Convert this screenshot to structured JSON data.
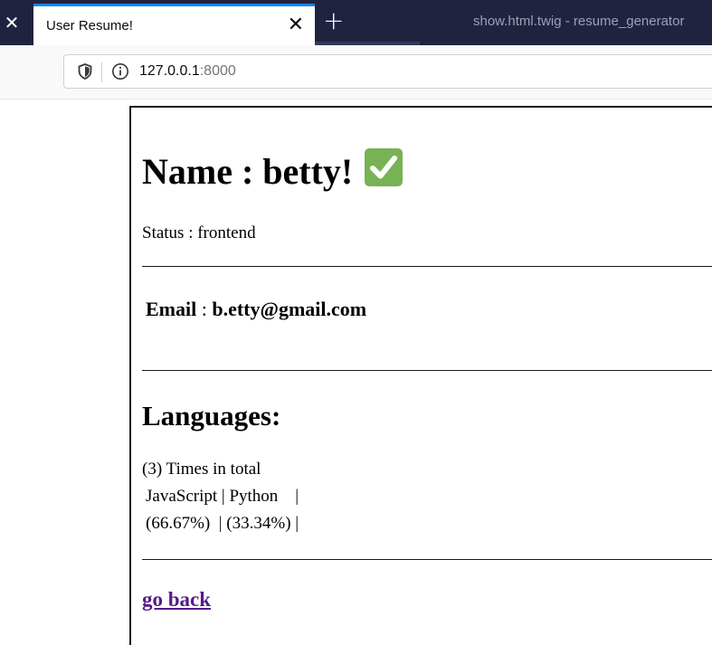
{
  "browser": {
    "tab_title": "User Resume!",
    "tab_close_glyph": "✕",
    "left_close_glyph": "✕",
    "new_tab_glyph": "+",
    "window_title": "show.html.twig - resume_generator",
    "url_host": "127.0.0.1",
    "url_port": ":8000",
    "accent_color": "#0a84ff"
  },
  "page": {
    "name_heading": "Name : betty!",
    "check_icon": "white-check-mark-icon",
    "status": "Status : frontend",
    "email_label": "Email",
    "email_sep": " : ",
    "email_value": "b.etty@gmail.com",
    "languages_heading": "Languages:",
    "languages_total": "(3) Times in total",
    "languages_names_line": "JavaScript | Python    |",
    "languages_percent_line": "(66.67%)  | (33.34%) |",
    "languages": [
      {
        "name": "JavaScript",
        "percent": "66.67%"
      },
      {
        "name": "Python",
        "percent": "33.34%"
      }
    ],
    "go_back": "go back",
    "link_color": "#551a8b",
    "check_color": "#77b255"
  }
}
